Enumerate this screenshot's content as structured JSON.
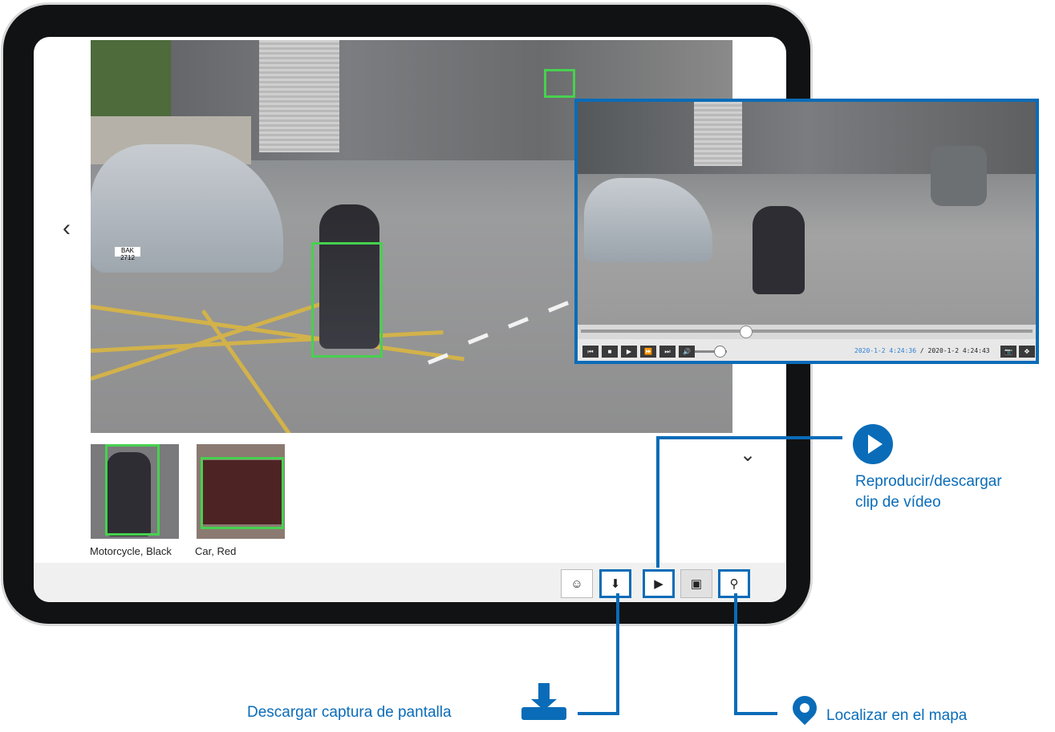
{
  "player": {
    "current_time": "2020-1-2 4:24:36",
    "separator": " / ",
    "end_time": "2020-1-2 4:24:43",
    "progress_fraction": 0.36,
    "volume_fraction": 0.75
  },
  "thumbnails": [
    {
      "label": "Motorcycle, Black"
    },
    {
      "label": "Car, Red"
    }
  ],
  "toolbar": {
    "buttons": [
      "face-detect-icon",
      "download-icon",
      "play-icon",
      "image-icon",
      "map-pin-icon"
    ]
  },
  "callouts": {
    "play": "Reproducir/descargar\nclip de vídeo",
    "download": "Descargar captura de pantalla",
    "map": "Localizar en el mapa"
  },
  "plates": {
    "car": "BAK 2712"
  },
  "colors": {
    "accent": "#0a6cb8",
    "bbox": "#47d14f"
  }
}
